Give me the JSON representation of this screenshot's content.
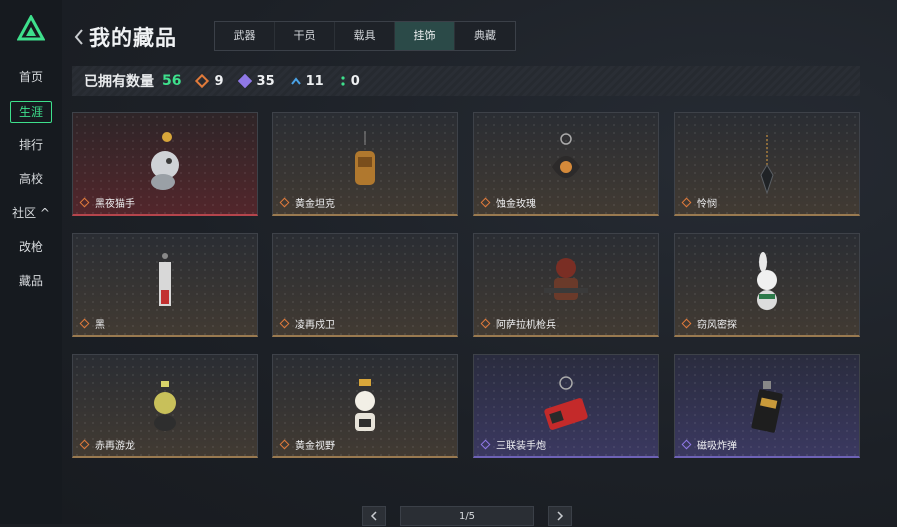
{
  "sidebar": {
    "items": [
      {
        "label": "首页",
        "active": false
      },
      {
        "label": "生涯",
        "active": true
      },
      {
        "label": "排行",
        "active": false
      },
      {
        "label": "高校",
        "active": false
      },
      {
        "label": "社区 ^",
        "active": false
      },
      {
        "label": "改枪",
        "active": false
      },
      {
        "label": "藏品",
        "active": false
      }
    ]
  },
  "header": {
    "title": "我的藏品",
    "tabs": [
      {
        "label": "武器",
        "active": false
      },
      {
        "label": "干员",
        "active": false
      },
      {
        "label": "载具",
        "active": false
      },
      {
        "label": "挂饰",
        "active": true
      },
      {
        "label": "典藏",
        "active": false
      }
    ]
  },
  "stats": {
    "label": "已拥有数量",
    "total": "56",
    "orange": "9",
    "purple": "35",
    "blue": "11",
    "green": "0"
  },
  "items": [
    {
      "name": "黑夜猫手",
      "rarity": "orange",
      "card": "red",
      "icon": "cat-charm-icon"
    },
    {
      "name": "黄金坦克",
      "rarity": "orange",
      "card": "gold",
      "icon": "tank-charm-icon"
    },
    {
      "name": "蚀金玫瑰",
      "rarity": "orange",
      "card": "gold",
      "icon": "rose-charm-icon"
    },
    {
      "name": "怜悯",
      "rarity": "orange",
      "card": "gold",
      "icon": "dagger-charm-icon"
    },
    {
      "name": "黑",
      "rarity": "orange",
      "card": "gold",
      "icon": "tag-charm-icon"
    },
    {
      "name": "凌再戍卫",
      "rarity": "orange",
      "card": "gold",
      "icon": "empty-icon"
    },
    {
      "name": "阿萨拉机枪兵",
      "rarity": "orange",
      "card": "gold",
      "icon": "gunner-charm-icon"
    },
    {
      "name": "窃风密探",
      "rarity": "orange",
      "card": "gold",
      "icon": "rabbit-charm-icon"
    },
    {
      "name": "赤再游龙",
      "rarity": "orange",
      "card": "gold",
      "icon": "dragon-charm-icon"
    },
    {
      "name": "黄金视野",
      "rarity": "orange",
      "card": "gold",
      "icon": "robot-charm-icon"
    },
    {
      "name": "三联装手炮",
      "rarity": "purple",
      "card": "purple",
      "icon": "cannon-charm-icon"
    },
    {
      "name": "磁吸炸弹",
      "rarity": "purple",
      "card": "purple",
      "icon": "bomb-charm-icon"
    }
  ],
  "pagination": {
    "text": "1/5"
  },
  "colors": {
    "accent": "#3ee08c",
    "orange_rarity": "#e07a3a",
    "purple_rarity": "#8f78e6",
    "blue_rarity": "#4aa3e8"
  }
}
